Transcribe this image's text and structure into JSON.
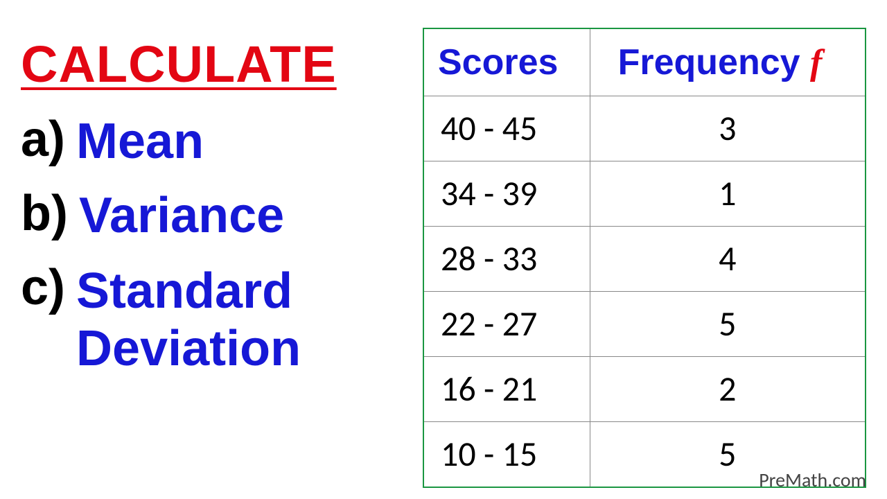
{
  "title": "CALCULATE",
  "items": [
    {
      "label": "a)",
      "text": "Mean"
    },
    {
      "label": "b)",
      "text": "Variance"
    },
    {
      "label": "c)",
      "text": "Standard\nDeviation"
    }
  ],
  "table": {
    "headers": {
      "col1": "Scores",
      "col2_text": "Frequency ",
      "col2_symbol": "f"
    },
    "rows": [
      {
        "scores": "40 - 45",
        "frequency": "3"
      },
      {
        "scores": "34 - 39",
        "frequency": "1"
      },
      {
        "scores": "28 - 33",
        "frequency": "4"
      },
      {
        "scores": "22 - 27",
        "frequency": "5"
      },
      {
        "scores": "16 - 21",
        "frequency": "2"
      },
      {
        "scores": "10 - 15",
        "frequency": "5"
      }
    ]
  },
  "watermark": "PreMath.com",
  "chart_data": {
    "type": "table",
    "title": "Frequency Distribution Table",
    "columns": [
      "Scores",
      "Frequency"
    ],
    "data": [
      {
        "score_range": "40 - 45",
        "low": 40,
        "high": 45,
        "frequency": 3
      },
      {
        "score_range": "34 - 39",
        "low": 34,
        "high": 39,
        "frequency": 1
      },
      {
        "score_range": "28 - 33",
        "low": 28,
        "high": 33,
        "frequency": 4
      },
      {
        "score_range": "22 - 27",
        "low": 22,
        "high": 27,
        "frequency": 5
      },
      {
        "score_range": "16 - 21",
        "low": 16,
        "high": 21,
        "frequency": 2
      },
      {
        "score_range": "10 - 15",
        "low": 10,
        "high": 15,
        "frequency": 5
      }
    ]
  }
}
